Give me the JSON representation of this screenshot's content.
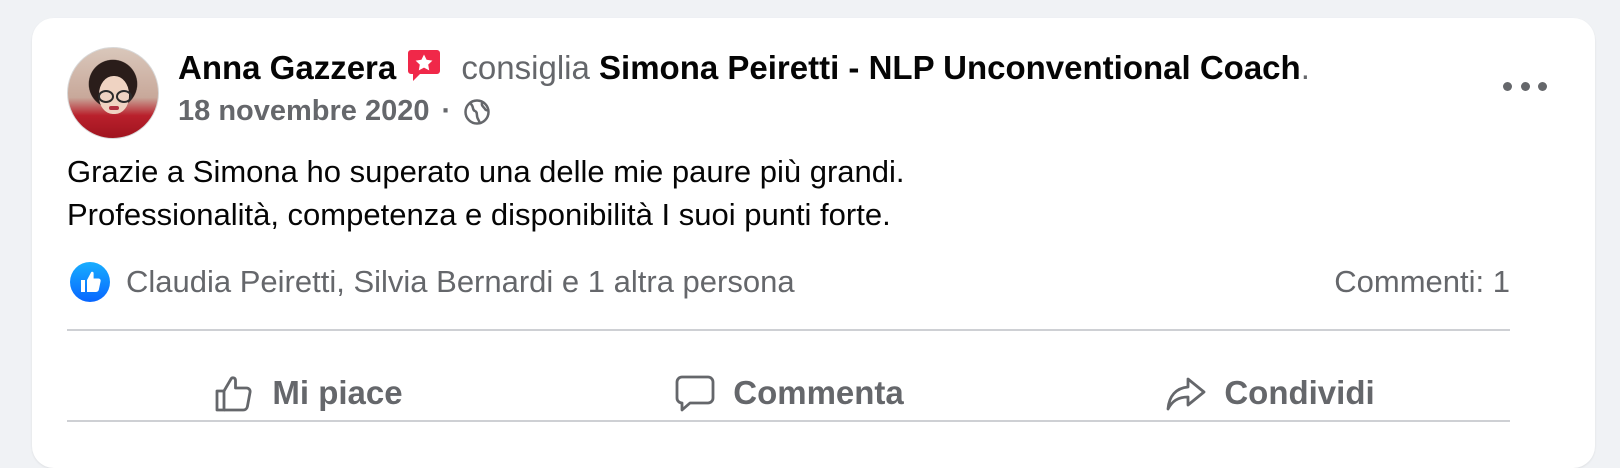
{
  "post": {
    "author": "Anna Gazzera",
    "verb": "consiglia",
    "page": "Simona Peiretti - NLP Unconventional Coach",
    "period": ".",
    "date": "18 novembre 2020",
    "separator": "·",
    "audience_icon": "globe-icon",
    "badge_icon": "recommendation-star-icon",
    "text_lines": [
      "Grazie a Simona ho superato una delle mie paure più grandi.",
      "Professionalità, competenza e disponibilità I suoi punti forte."
    ]
  },
  "reactions": {
    "icon": "like-icon",
    "names": "Claudia Peiretti, Silvia Bernardi e 1 altra persona",
    "comments": "Commenti: 1"
  },
  "actions": {
    "like": "Mi piace",
    "comment": "Commenta",
    "share": "Condividi"
  },
  "colors": {
    "background": "#f0f2f5",
    "card": "#ffffff",
    "text": "#050505",
    "secondary_text": "#65676b",
    "like_blue": "#0866ff",
    "badge_red": "#f02849"
  }
}
